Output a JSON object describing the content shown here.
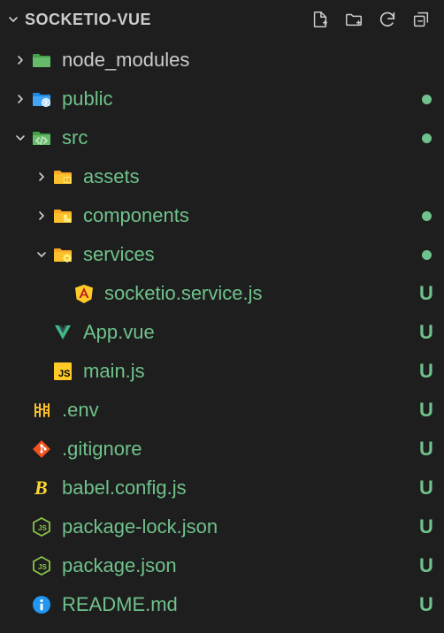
{
  "header": {
    "title": "SOCKETIO-VUE",
    "actions": [
      "new-file",
      "new-folder",
      "refresh",
      "collapse-all"
    ]
  },
  "tree": [
    {
      "depth": 0,
      "expanded": false,
      "kind": "folder",
      "icon": "folder-green",
      "label": "node_modules",
      "labelPlain": true,
      "status": ""
    },
    {
      "depth": 0,
      "expanded": false,
      "kind": "folder",
      "icon": "folder-public",
      "label": "public",
      "labelPlain": false,
      "status": "dot"
    },
    {
      "depth": 0,
      "expanded": true,
      "kind": "folder",
      "icon": "folder-src",
      "label": "src",
      "labelPlain": false,
      "status": "dot"
    },
    {
      "depth": 1,
      "expanded": false,
      "kind": "folder",
      "icon": "folder-assets",
      "label": "assets",
      "labelPlain": false,
      "status": ""
    },
    {
      "depth": 1,
      "expanded": false,
      "kind": "folder",
      "icon": "folder-comp",
      "label": "components",
      "labelPlain": false,
      "status": "dot"
    },
    {
      "depth": 1,
      "expanded": true,
      "kind": "folder",
      "icon": "folder-svc",
      "label": "services",
      "labelPlain": false,
      "status": "dot"
    },
    {
      "depth": 2,
      "expanded": null,
      "kind": "file",
      "icon": "angular",
      "label": "socketio.service.js",
      "labelPlain": false,
      "status": "U"
    },
    {
      "depth": 1,
      "expanded": null,
      "kind": "file",
      "icon": "vue",
      "label": "App.vue",
      "labelPlain": false,
      "status": "U"
    },
    {
      "depth": 1,
      "expanded": null,
      "kind": "file",
      "icon": "js",
      "label": "main.js",
      "labelPlain": false,
      "status": "U"
    },
    {
      "depth": 0,
      "expanded": null,
      "kind": "file",
      "icon": "env",
      "label": ".env",
      "labelPlain": false,
      "status": "U"
    },
    {
      "depth": 0,
      "expanded": null,
      "kind": "file",
      "icon": "git",
      "label": ".gitignore",
      "labelPlain": false,
      "status": "U"
    },
    {
      "depth": 0,
      "expanded": null,
      "kind": "file",
      "icon": "babel",
      "label": "babel.config.js",
      "labelPlain": false,
      "status": "U"
    },
    {
      "depth": 0,
      "expanded": null,
      "kind": "file",
      "icon": "node",
      "label": "package-lock.json",
      "labelPlain": false,
      "status": "U"
    },
    {
      "depth": 0,
      "expanded": null,
      "kind": "file",
      "icon": "node",
      "label": "package.json",
      "labelPlain": false,
      "status": "U"
    },
    {
      "depth": 0,
      "expanded": null,
      "kind": "file",
      "icon": "info",
      "label": "README.md",
      "labelPlain": false,
      "status": "U"
    }
  ],
  "colors": {
    "folderBase": "#43a047",
    "folderAccent": "#80c684",
    "yellowFolder": "#f9a825",
    "yellowAccent": "#ffd54f",
    "js": "#ffca28",
    "angular": "#ffca28",
    "vue": "#41b883",
    "env": "#fbc02d",
    "git": "#f4511e",
    "babel": "#fdd835",
    "node": "#8bc34a",
    "info": "#2196f3"
  }
}
